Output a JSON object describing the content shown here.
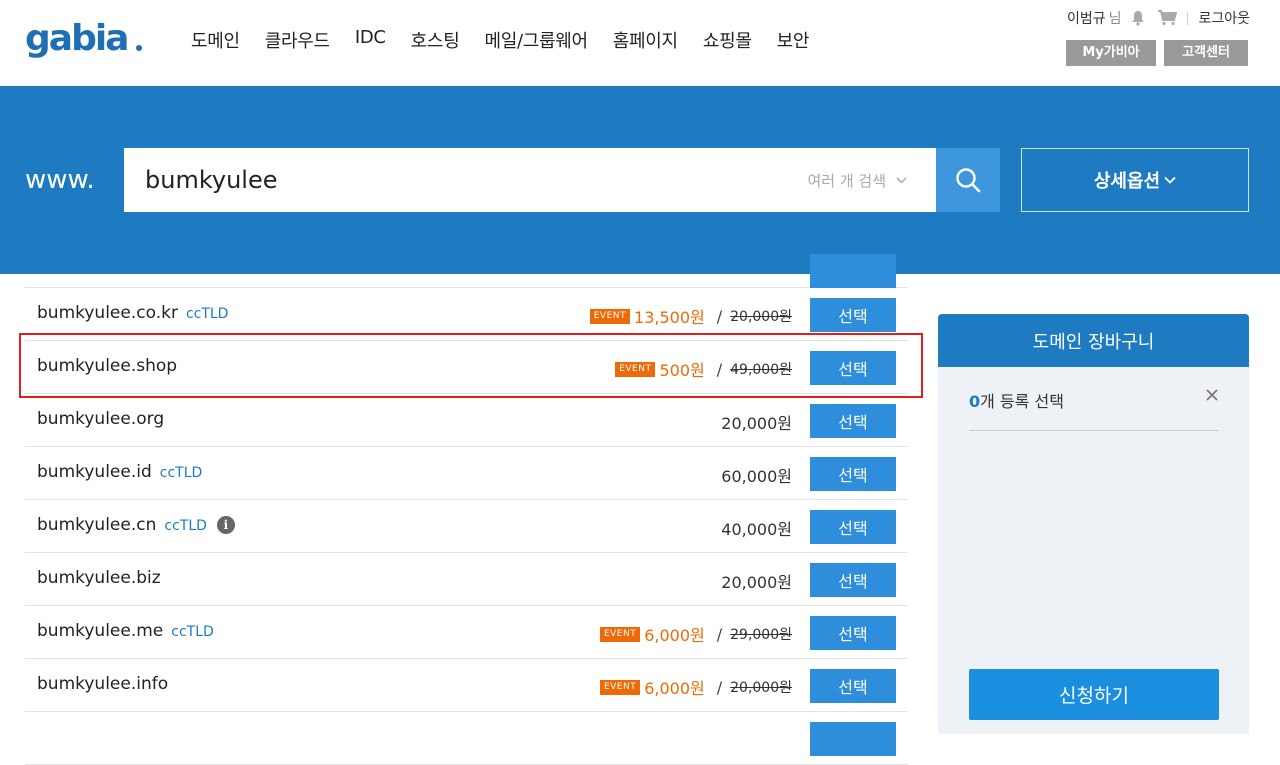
{
  "header": {
    "logo_text": "gabia.",
    "nav": [
      "도메인",
      "클라우드",
      "IDC",
      "호스팅",
      "메일/그룹웨어",
      "홈페이지",
      "쇼핑몰",
      "보안"
    ],
    "user_name": "이범규",
    "user_suffix": "님",
    "logout": "로그아웃",
    "my_gabia": "My가비아",
    "support": "고객센터"
  },
  "search": {
    "prefix": "www.",
    "value": "bumkyulee",
    "multi_label": "여러 개 검색",
    "detail_label": "상세옵션"
  },
  "results": [
    {
      "domain": "bumkyulee.co.kr",
      "tld_tag": "ccTLD",
      "event": "EVENT",
      "sale": "13,500원",
      "orig": "20,000원",
      "button": "선택"
    },
    {
      "domain": "bumkyulee.shop",
      "tld_tag": "",
      "event": "EVENT",
      "sale": "500원",
      "orig": "49,000원",
      "button": "선택",
      "highlighted": true
    },
    {
      "domain": "bumkyulee.org",
      "tld_tag": "",
      "price": "20,000원",
      "button": "선택"
    },
    {
      "domain": "bumkyulee.id",
      "tld_tag": "ccTLD",
      "price": "60,000원",
      "button": "선택"
    },
    {
      "domain": "bumkyulee.cn",
      "tld_tag": "ccTLD",
      "info_icon": "i",
      "price": "40,000원",
      "button": "선택"
    },
    {
      "domain": "bumkyulee.biz",
      "tld_tag": "",
      "price": "20,000원",
      "button": "선택"
    },
    {
      "domain": "bumkyulee.me",
      "tld_tag": "ccTLD",
      "event": "EVENT",
      "sale": "6,000원",
      "orig": "29,000원",
      "button": "선택"
    },
    {
      "domain": "bumkyulee.info",
      "tld_tag": "",
      "event": "EVENT",
      "sale": "6,000원",
      "orig": "20,000원",
      "button": "선택"
    }
  ],
  "cart": {
    "title": "도메인 장바구니",
    "count": "0",
    "count_label": "개 등록 선택",
    "apply": "신청하기"
  },
  "colors": {
    "brand_blue": "#1f7bc1",
    "button_blue": "#2f8edb",
    "event_orange": "#ee6a08",
    "highlight_red": "#e0201f"
  }
}
